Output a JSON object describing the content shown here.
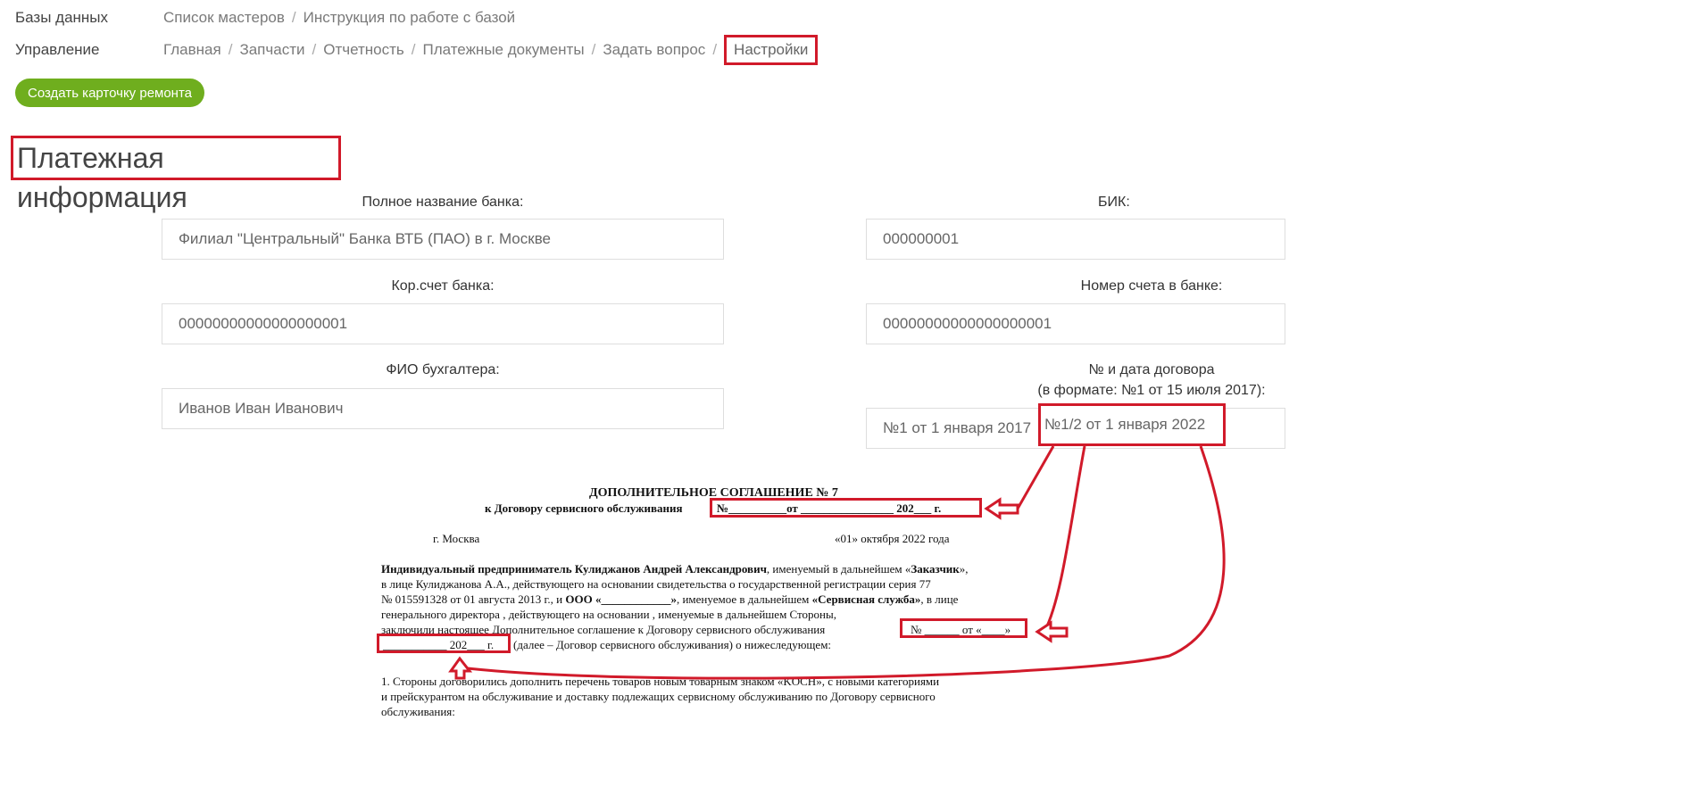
{
  "nav": {
    "databases": {
      "section": "Базы данных",
      "links": [
        "Список мастеров",
        "Инструкция по работе с базой"
      ]
    },
    "management": {
      "section": "Управление",
      "links": [
        "Главная",
        "Запчасти",
        "Отчетность",
        "Платежные документы",
        "Задать вопрос"
      ],
      "active": "Настройки"
    },
    "sep": "/"
  },
  "create_button": "Создать карточку ремонта",
  "page_title": "Платежная информация",
  "form": {
    "bank_name": {
      "label": "Полное название банка:",
      "value": "Филиал \"Центральный\" Банка ВТБ (ПАО) в г. Москве"
    },
    "bik": {
      "label": "БИК:",
      "value": "000000001"
    },
    "kor_account": {
      "label": "Кор.счет банка:",
      "value": "00000000000000000001"
    },
    "account_number": {
      "label": "Номер счета в банке:",
      "value": "00000000000000000001"
    },
    "accountant": {
      "label": "ФИО бухгалтера:",
      "value": "Иванов Иван Иванович"
    },
    "contract": {
      "label": "№ и дата договора",
      "label_hint": "(в формате: №1 от 15 июля 2017):",
      "value": "№1 от 1 января 2017",
      "overlay": "№1/2 от   1 января 2022"
    }
  },
  "document": {
    "title": "ДОПОЛНИТЕЛЬНОЕ СОГЛАШЕНИЕ №  7",
    "subtitle_left": "к Договору сервисного обслуживания",
    "subtitle_blank": "№__________от ________________ 202___ г.",
    "city": "г. Москва",
    "date": "«01» октября 2022 года",
    "p1_bold": "Индивидуальный предприниматель Кулиджанов Андрей Александрович",
    "p1_a": ", именуемый в дальнейшем «",
    "p1_customer": "Заказчик",
    "p1_b": "»,",
    "p2": "в лице Кулиджанова А.А., действующего на основании свидетельства о государственной регистрации серия 77",
    "p3_a": "№ 015591328 от 01 августа 2013 г., и ",
    "p3_ooo": "ООО «____________»",
    "p3_b": ", именуемое в дальнейшем ",
    "p3_service": "«Сервисная служба»",
    "p3_c": ", в лице",
    "p4": "генерального директора                    , действующего на основании              , именуемые в дальнейшем Стороны,",
    "p5": "заключили настоящее Дополнительное соглашение к Договору сервисного обслуживания",
    "p5_blank": "№ ______ от «____»",
    "p6_blank": "___________ 202___ г.",
    "p6": "(далее – Договор сервисного обслуживания) о нижеследующем:",
    "item1_a": "1.  Стороны договорились дополнить перечень товаров новым товарным знаком «KOCH», с новыми категориями",
    "item1_b": "и прейскурантом на обслуживание и доставку подлежащих сервисному обслуживанию по Договору сервисного",
    "item1_c": "обслуживания:"
  },
  "colors": {
    "accent_green": "#6fae1e",
    "annotation_red": "#d11a2a"
  }
}
